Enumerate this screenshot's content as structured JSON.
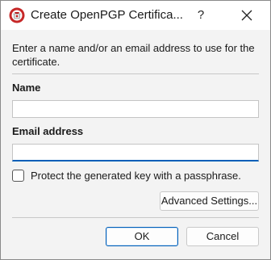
{
  "window": {
    "title": "Create OpenPGP Certifica...",
    "help_label": "?"
  },
  "form": {
    "description": "Enter a name and/or an email address to use for the certificate.",
    "name_label": "Name",
    "name_value": "",
    "email_label": "Email address",
    "email_value": "",
    "passphrase_label": "Protect the generated key with a passphrase.",
    "passphrase_checked": false,
    "advanced_button": "Advanced Settings..."
  },
  "footer": {
    "ok_button": "OK",
    "cancel_button": "Cancel"
  },
  "colors": {
    "accent": "#005fb8",
    "app_icon": "#c62828"
  }
}
